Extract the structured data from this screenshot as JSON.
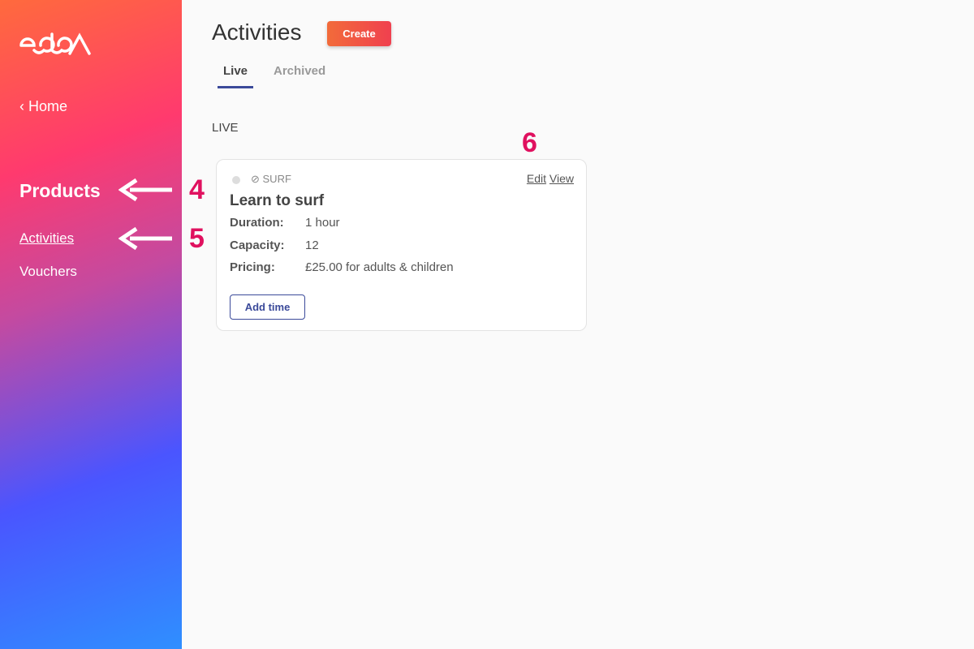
{
  "sidebar": {
    "logo": "eola",
    "home": "Home",
    "section": "Products",
    "items": [
      {
        "label": "Activities"
      },
      {
        "label": "Vouchers"
      }
    ]
  },
  "annotations": [
    "4",
    "5",
    "6"
  ],
  "header": {
    "title": "Activities",
    "create_label": "Create"
  },
  "tabs": [
    {
      "label": "Live",
      "active": true
    },
    {
      "label": "Archived",
      "active": false
    }
  ],
  "section_label": "LIVE",
  "card": {
    "tag": "SURF",
    "edit": "Edit",
    "view": "View",
    "name": "Learn to surf",
    "fields": [
      {
        "label": "Duration:",
        "value": "1 hour"
      },
      {
        "label": "Capacity:",
        "value": "12"
      },
      {
        "label": "Pricing:",
        "value": "£25.00 for adults & children"
      }
    ],
    "add_time": "Add time"
  },
  "colors": {
    "accent": "#3b4a9a",
    "annotation": "#e0115f"
  }
}
